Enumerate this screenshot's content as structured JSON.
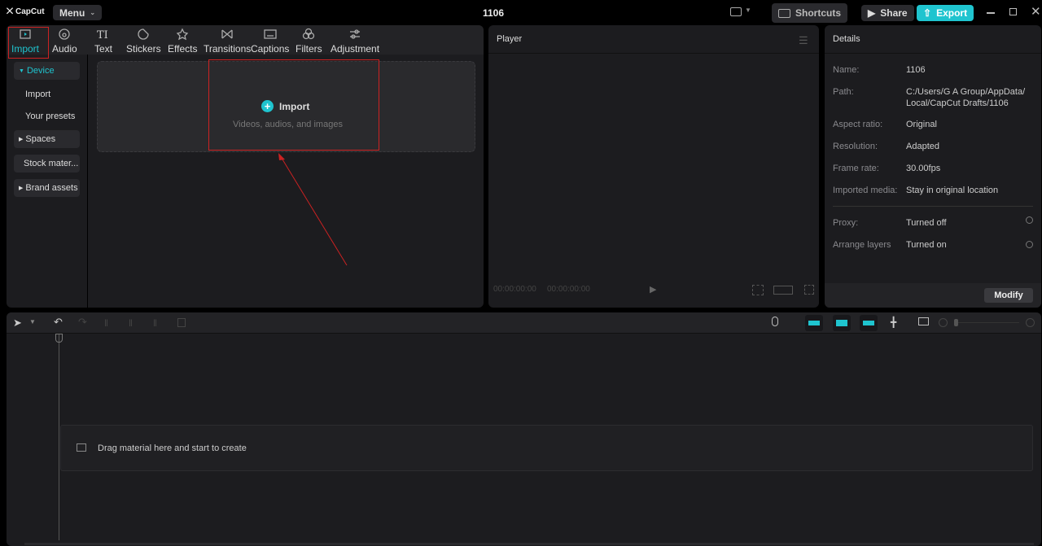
{
  "app": {
    "logo": "CapCut",
    "menu": "Menu",
    "title": "1106",
    "shortcuts": "Shortcuts",
    "share": "Share",
    "export": "Export",
    "accent": "#1fc4cf"
  },
  "tabs": [
    {
      "label": "Import",
      "icon": "import-icon",
      "active": true
    },
    {
      "label": "Audio",
      "icon": "audio-icon"
    },
    {
      "label": "Text",
      "icon": "text-icon"
    },
    {
      "label": "Stickers",
      "icon": "sticker-icon"
    },
    {
      "label": "Effects",
      "icon": "effects-icon"
    },
    {
      "label": "Transitions",
      "icon": "transitions-icon"
    },
    {
      "label": "Captions",
      "icon": "captions-icon"
    },
    {
      "label": "Filters",
      "icon": "filters-icon"
    },
    {
      "label": "Adjustment",
      "icon": "adjustment-icon"
    }
  ],
  "sidebar": {
    "device": "Device",
    "import": "Import",
    "presets": "Your presets",
    "spaces": "Spaces",
    "stock": "Stock mater...",
    "brand": "Brand assets"
  },
  "importbox": {
    "label": "Import",
    "sub": "Videos, audios, and images"
  },
  "player": {
    "title": "Player",
    "time_current": "00:00:00:00",
    "time_total": "00:00:00:00"
  },
  "details": {
    "title": "Details",
    "rows": [
      {
        "k": "Name:",
        "v": "1106"
      },
      {
        "k": "Path:",
        "v": "C:/Users/G A Group/AppData/ Local/CapCut Drafts/1106"
      },
      {
        "k": "Aspect ratio:",
        "v": "Original"
      },
      {
        "k": "Resolution:",
        "v": "Adapted"
      },
      {
        "k": "Frame rate:",
        "v": "30.00fps"
      },
      {
        "k": "Imported media:",
        "v": "Stay in original location"
      },
      {
        "k": "Proxy:",
        "v": "Turned off"
      },
      {
        "k": "Arrange layers",
        "v": "Turned on"
      }
    ],
    "modify": "Modify"
  },
  "timeline": {
    "placeholder": "Drag material here and start to create"
  }
}
